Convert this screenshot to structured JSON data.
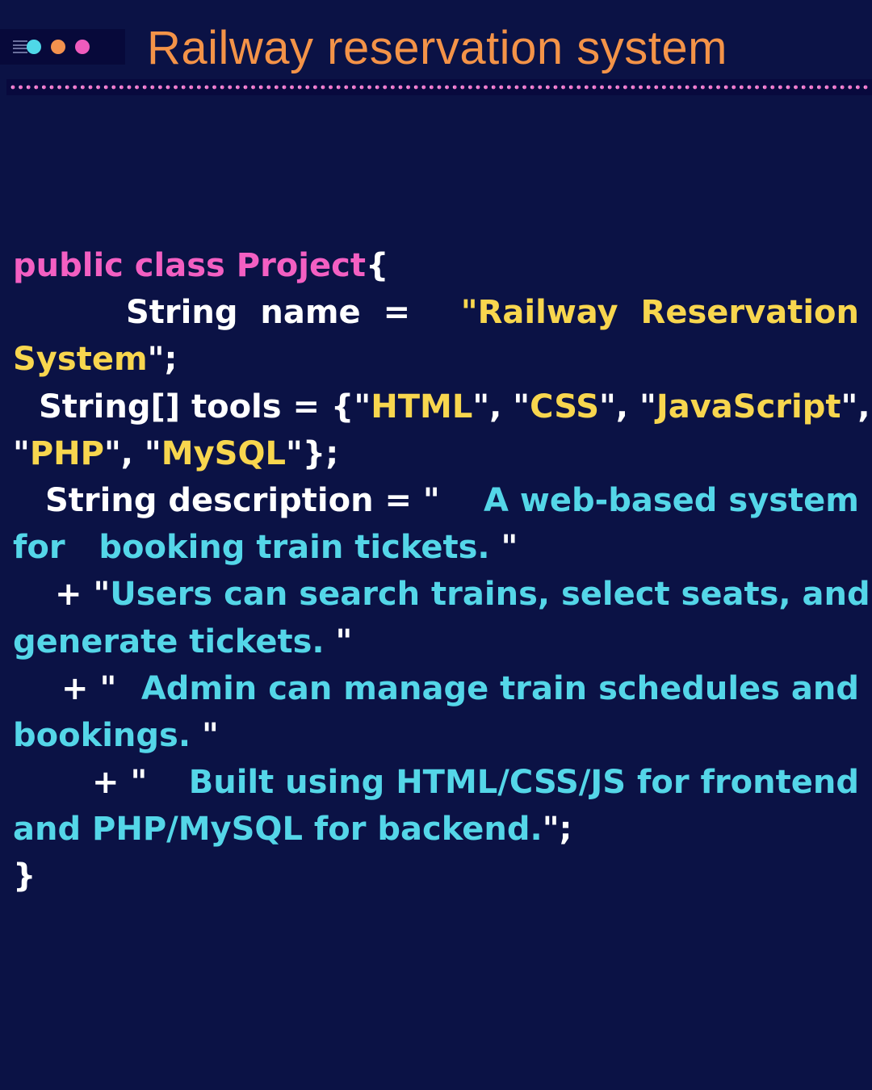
{
  "header": {
    "title": "Railway reservation system",
    "dot_colors": [
      "#4fd8e8",
      "#f3924e",
      "#ef5bbd"
    ]
  },
  "colors": {
    "background": "#0b1245",
    "title": "#f49348",
    "keyword": "#f35fc2",
    "string": "#f8d64e",
    "description": "#54d6e8",
    "plain": "#ffffff"
  },
  "code": {
    "l1_kw": "public class Project",
    "l1_brace": " {",
    "l2_indent": "String name =",
    "l2_str": "\"Railway Reservation",
    "l3_str": "System",
    "l3_end": "\";",
    "l4_indent": "String[] tools = {\"",
    "l4_s1": "HTML",
    "l4_sep1": "\", \"",
    "l4_s2": "CSS",
    "l4_sep2": "\", \"",
    "l4_s3": "JavaScript",
    "l4_end": "\",",
    "l5_open": "\"",
    "l5_s1": "PHP",
    "l5_sep": "\", \"",
    "l5_s2": "MySQL",
    "l5_end": "\"};",
    "l6_indent": "String description = \"",
    "l6_desc": "A web-based system",
    "l7_desc": "for   booking train tickets. ",
    "l7_end": "\"",
    "l8_plus": "+ \"",
    "l8_desc": "Users can search trains, select seats, and",
    "l9_desc": "generate tickets. ",
    "l9_end": "\"",
    "l10_plus": "+ \"",
    "l10_desc": "Admin can manage train schedules and",
    "l11_desc": "bookings. ",
    "l11_end": "\"",
    "l12_plus": "+ \"",
    "l12_desc": "Built using HTML/CSS/JS for frontend",
    "l13_desc": "and PHP/MySQL for backend.",
    "l13_end": "\";",
    "l14_brace": "}"
  }
}
